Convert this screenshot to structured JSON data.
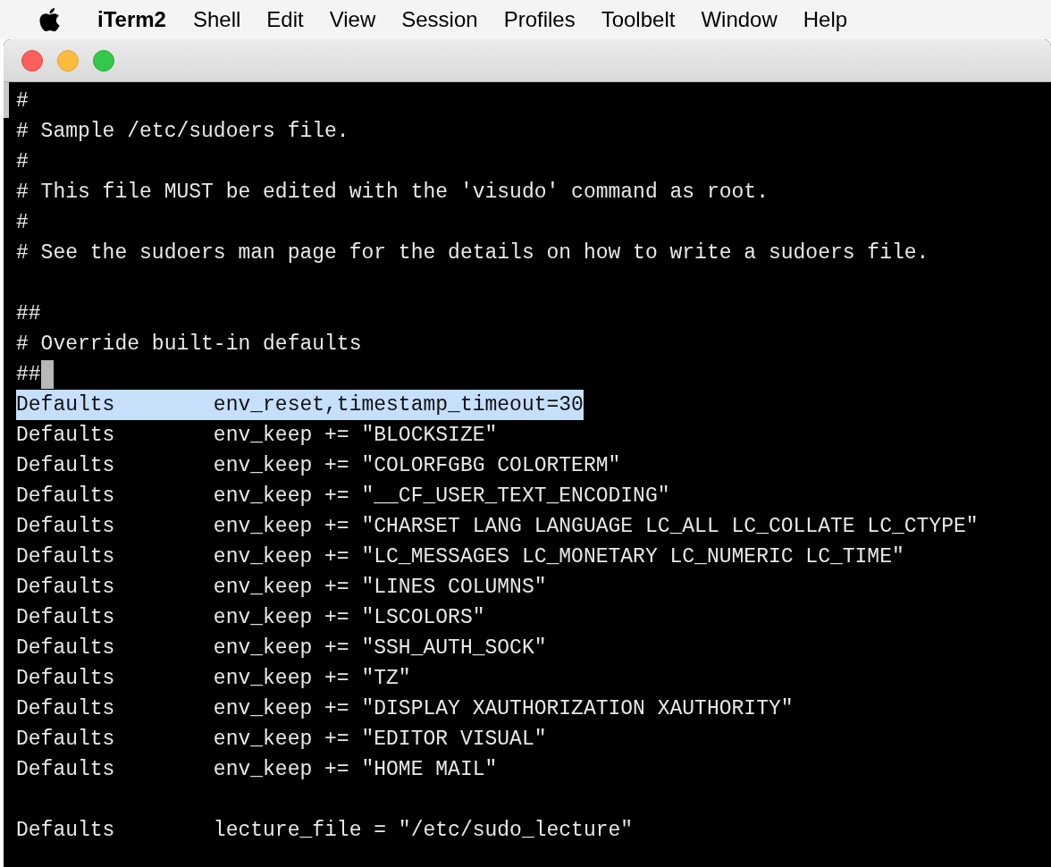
{
  "menu_bar": {
    "app_name": "iTerm2",
    "items": [
      "Shell",
      "Edit",
      "View",
      "Session",
      "Profiles",
      "Toolbelt",
      "Window",
      "Help"
    ]
  },
  "terminal": {
    "lines": [
      {
        "kind": "text",
        "text": "#"
      },
      {
        "kind": "text",
        "text": "# Sample /etc/sudoers file."
      },
      {
        "kind": "text",
        "text": "#"
      },
      {
        "kind": "text",
        "text": "# This file MUST be edited with the 'visudo' command as root."
      },
      {
        "kind": "text",
        "text": "#"
      },
      {
        "kind": "text",
        "text": "# See the sudoers man page for the details on how to write a sudoers file."
      },
      {
        "kind": "blank"
      },
      {
        "kind": "text",
        "text": "##"
      },
      {
        "kind": "text",
        "text": "# Override built-in defaults"
      },
      {
        "kind": "cursor_line",
        "text": "##"
      },
      {
        "kind": "highlighted",
        "text": "Defaults        env_reset,timestamp_timeout=30"
      },
      {
        "kind": "text",
        "text": "Defaults        env_keep += \"BLOCKSIZE\""
      },
      {
        "kind": "text",
        "text": "Defaults        env_keep += \"COLORFGBG COLORTERM\""
      },
      {
        "kind": "text",
        "text": "Defaults        env_keep += \"__CF_USER_TEXT_ENCODING\""
      },
      {
        "kind": "text",
        "text": "Defaults        env_keep += \"CHARSET LANG LANGUAGE LC_ALL LC_COLLATE LC_CTYPE\""
      },
      {
        "kind": "text",
        "text": "Defaults        env_keep += \"LC_MESSAGES LC_MONETARY LC_NUMERIC LC_TIME\""
      },
      {
        "kind": "text",
        "text": "Defaults        env_keep += \"LINES COLUMNS\""
      },
      {
        "kind": "text",
        "text": "Defaults        env_keep += \"LSCOLORS\""
      },
      {
        "kind": "text",
        "text": "Defaults        env_keep += \"SSH_AUTH_SOCK\""
      },
      {
        "kind": "text",
        "text": "Defaults        env_keep += \"TZ\""
      },
      {
        "kind": "text",
        "text": "Defaults        env_keep += \"DISPLAY XAUTHORIZATION XAUTHORITY\""
      },
      {
        "kind": "text",
        "text": "Defaults        env_keep += \"EDITOR VISUAL\""
      },
      {
        "kind": "text",
        "text": "Defaults        env_keep += \"HOME MAIL\""
      },
      {
        "kind": "blank"
      },
      {
        "kind": "text",
        "text": "Defaults        lecture_file = \"/etc/sudo_lecture\""
      }
    ]
  }
}
